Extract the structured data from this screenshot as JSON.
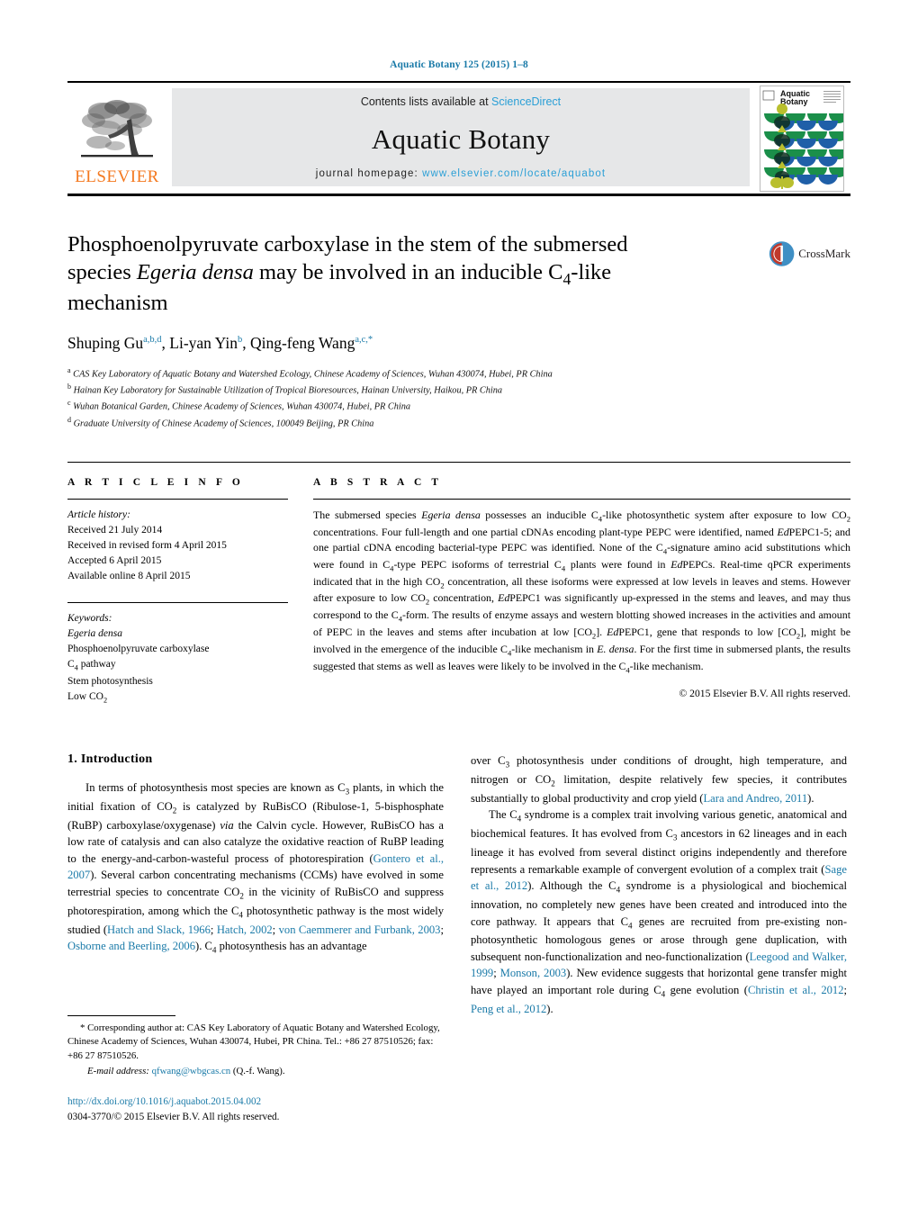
{
  "running_head": "Aquatic Botany 125 (2015) 1–8",
  "masthead": {
    "elsevier_wordmark": "ELSEVIER",
    "contents_prefix": "Contents lists available at ",
    "contents_link": "ScienceDirect",
    "journal_name": "Aquatic Botany",
    "homepage_prefix": "journal homepage: ",
    "homepage_url": "www.elsevier.com/locate/aquabot",
    "cover_title_line1": "Aquatic",
    "cover_title_line2": "Botany"
  },
  "article": {
    "title_line1": "Phosphoenolpyruvate carboxylase in the stem of the submersed",
    "title_line2_a": "species ",
    "title_line2_species": "Egeria densa",
    "title_line2_b": " may be involved in an inducible C",
    "title_line2_sub": "4",
    "title_line2_c": "-like",
    "title_line3": "mechanism",
    "crossmark_label": "CrossMark",
    "authors": [
      {
        "name": "Shuping Gu",
        "marks": "a,b,d",
        "sep": ", "
      },
      {
        "name": "Li-yan Yin",
        "marks": "b",
        "sep": ", "
      },
      {
        "name": "Qing-feng Wang",
        "marks": "a,c,*",
        "sep": ""
      }
    ],
    "affiliations": [
      {
        "mark": "a",
        "text": "CAS Key Laboratory of Aquatic Botany and Watershed Ecology, Chinese Academy of Sciences, Wuhan 430074, Hubei, PR China"
      },
      {
        "mark": "b",
        "text": "Hainan Key Laboratory for Sustainable Utilization of Tropical Bioresources, Hainan University, Haikou, PR China"
      },
      {
        "mark": "c",
        "text": "Wuhan Botanical Garden, Chinese Academy of Sciences, Wuhan 430074, Hubei, PR China"
      },
      {
        "mark": "d",
        "text": "Graduate University of Chinese Academy of Sciences, 100049 Beijing, PR China"
      }
    ]
  },
  "article_info": {
    "heading": "A R T I C L E    I N F O",
    "history_label": "Article history:",
    "history": [
      "Received 21 July 2014",
      "Received in revised form 4 April 2015",
      "Accepted 6 April 2015",
      "Available online 8 April 2015"
    ],
    "keywords_label": "Keywords:",
    "keywords": [
      "Egeria densa",
      "Phosphoenolpyruvate carboxylase",
      "C4 pathway",
      "Stem photosynthesis",
      "Low CO2"
    ]
  },
  "abstract": {
    "heading": "A B S T R A C T",
    "text": "The submersed species Egeria densa possesses an inducible C4-like photosynthetic system after exposure to low CO2 concentrations. Four full-length and one partial cDNAs encoding plant-type PEPC were identified, named EdPEPC1-5; and one partial cDNA encoding bacterial-type PEPC was identified. None of the C4-signature amino acid substitutions which were found in C4-type PEPC isoforms of terrestrial C4 plants were found in EdPEPCs. Real-time qPCR experiments indicated that in the high CO2 concentration, all these isoforms were expressed at low levels in leaves and stems. However after exposure to low CO2 concentration, EdPEPC1 was significantly up-expressed in the stems and leaves, and may thus correspond to the C4-form. The results of enzyme assays and western blotting showed increases in the activities and amount of PEPC in the leaves and stems after incubation at low [CO2]. EdPEPC1, gene that responds to low [CO2], might be involved in the emergence of the inducible C4-like mechanism in E. densa. For the first time in submersed plants, the results suggested that stems as well as leaves were likely to be involved in the C4-like mechanism.",
    "copyright": "© 2015 Elsevier B.V. All rights reserved."
  },
  "introduction": {
    "heading": "1.  Introduction",
    "left_paragraph_1": "In terms of photosynthesis most species are known as C3 plants, in which the initial fixation of CO2 is catalyzed by RuBisCO (Ribulose-1, 5-bisphosphate (RuBP) carboxylase/oxygenase) via the Calvin cycle. However, RuBisCO has a low rate of catalysis and can also catalyze the oxidative reaction of RuBP leading to the energy-and-carbon-wasteful process of photorespiration (Gontero et al., 2007). Several carbon concentrating mechanisms (CCMs) have evolved in some terrestrial species to concentrate CO2 in the vicinity of RuBisCO and suppress photorespiration, among which the C4 photosynthetic pathway is the most widely studied (Hatch and Slack, 1966; Hatch, 2002; von Caemmerer and Furbank, 2003; Osborne and Beerling, 2006). C4 photosynthesis has an advantage",
    "right_paragraph_1": "over C3 photosynthesis under conditions of drought, high temperature, and nitrogen or CO2 limitation, despite relatively few species, it contributes substantially to global productivity and crop yield (Lara and Andreo, 2011).",
    "right_paragraph_2": "The C4 syndrome is a complex trait involving various genetic, anatomical and biochemical features. It has evolved from C3 ancestors in 62 lineages and in each lineage it has evolved from several distinct origins independently and therefore represents a remarkable example of convergent evolution of a complex trait (Sage et al., 2012). Although the C4 syndrome is a physiological and biochemical innovation, no completely new genes have been created and introduced into the core pathway. It appears that C4 genes are recruited from pre-existing non-photosynthetic homologous genes or arose through gene duplication, with subsequent non-functionalization and neo-functionalization (Leegood and Walker, 1999; Monson, 2003). New evidence suggests that horizontal gene transfer might have played an important role during C4 gene evolution (Christin et al., 2012; Peng et al., 2012).",
    "citations_left": [
      "Gontero et al., 2007",
      "Hatch and Slack, 1966",
      "Hatch, 2002",
      "von Caemmerer and Furbank, 2003",
      "Osborne and Beerling, 2006"
    ],
    "citations_right": [
      "Lara and Andreo, 2011",
      "Sage et al., 2012",
      "Leegood and Walker, 1999",
      "Monson, 2003",
      "Christin et al., 2012",
      "Peng et al., 2012"
    ]
  },
  "footnote": {
    "corresponding_marker": "*",
    "corresponding_text": "Corresponding author at: CAS Key Laboratory of Aquatic Botany and Watershed Ecology, Chinese Academy of Sciences, Wuhan 430074, Hubei, PR China. Tel.: +86 27 87510526; fax: +86 27 87510526.",
    "email_label": "E-mail address:",
    "email": "qfwang@wbgcas.cn",
    "email_owner": "(Q.-f. Wang).",
    "doi_url": "http://dx.doi.org/10.1016/j.aquabot.2015.04.002",
    "issn_line": "0304-3770/© 2015 Elsevier B.V. All rights reserved."
  },
  "colors": {
    "link": "#1a7aa8",
    "sciencedirect": "#2a9fd6",
    "elsevier_orange": "#f47920",
    "band_gray": "#e6e7e8"
  }
}
